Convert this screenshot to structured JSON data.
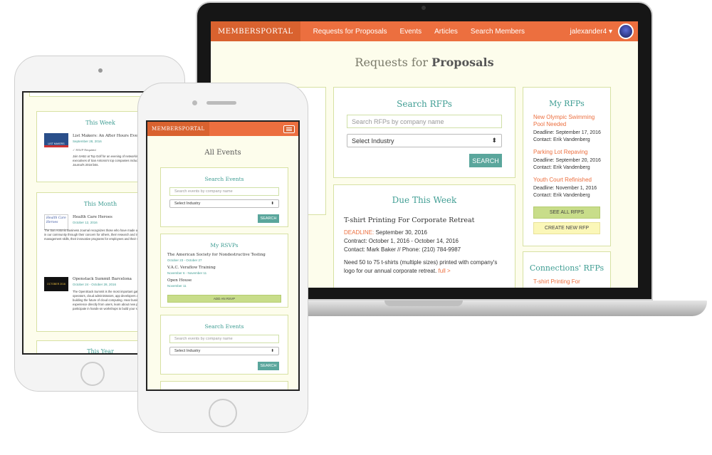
{
  "laptop": {
    "nav": {
      "brand": "MEMBERSPORTAL",
      "links": [
        "Requests for Proposals",
        "Events",
        "Articles",
        "Search Members"
      ],
      "user": "jalexander4 ▾"
    },
    "page_title_light": "Requests for",
    "page_title_bold": "Proposals",
    "search": {
      "title": "Search RFPs",
      "placeholder": "Search RFPs by company name",
      "select": "Select Industry",
      "button": "SEARCH"
    },
    "due": {
      "title": "Due This Week",
      "rfp_title": "T-shirt Printing For Corporate Retreat",
      "deadline_label": "DEADLINE:",
      "deadline": "September 30, 2016",
      "contract_label": "Contract:",
      "contract": "October 1, 2016 - October 14, 2016",
      "contact_label": "Contact:",
      "contact": "Mark Baker  //  Phone: (210) 784-9987",
      "desc": "Need 50 to 75 t-shirts (multiple sizes) printed with company's logo for our annual corporate retreat.",
      "more": "full >"
    },
    "my_rfps": {
      "title": "My RFPs",
      "items": [
        {
          "name": "New Olympic Swimming Pool Needed",
          "deadline": "Deadline: September 17, 2016",
          "contact": "Contact: Erik Vandenberg"
        },
        {
          "name": "Parking Lot Repaving",
          "deadline": "Deadline: September 20, 2016",
          "contact": "Contact: Erik Vandenberg"
        },
        {
          "name": "Youth Court Refinished",
          "deadline": "Deadline: November 1, 2016",
          "contact": "Contact: Erik Vandenberg"
        }
      ],
      "see_all": "SEE ALL RFPS",
      "create": "CREATE NEW RFP"
    },
    "connections": {
      "title": "Connections' RFPs",
      "first": "T-shirt Printing For"
    }
  },
  "tablet": {
    "this_week": {
      "title": "This Week",
      "event": "List Makers: An After Hours Event",
      "date": "September 28, 2016",
      "rsvp": "✓ RSVP Required",
      "thumb": "LIST MAKERS",
      "desc": "Join SABJ at Top Golf for an evening of networking and golf and meet the executives of San Antonio's top companies included in the San Antonio Business Journal's 2016 lists."
    },
    "this_month": {
      "title": "This Month",
      "event1": "Health Care Heroes",
      "date1": "October 12, 2016",
      "thumb1": "Health Care Heroes",
      "desc1": "The San Antonio Business Journal recognizes those who have made an impact on health care in our community through their concern for others, their research and inventions, their management skills, their innovative programs for employees and their services.",
      "event2": "Openstack Summit Barcelona",
      "date2": "October 24 - October 28, 2016",
      "thumb2": "OCTOBER 2016",
      "desc2": "The OpenStack Summit is the most important gathering of IT leaders, telco operators, cloud administrators, app developers and OpenStack contributors building the future of cloud computing. Hear business cases and operational experience directly from users, learn about new products in the ecosystem and participate in hands-on workshops to build your skills."
    },
    "this_year": {
      "title": "This Year"
    }
  },
  "phone": {
    "brand": "MEMBERSPORTAL",
    "page_title": "All Events",
    "search": {
      "title": "Search Events",
      "placeholder": "Search events by company name",
      "select": "Select Industry",
      "button": "SEARCH"
    },
    "rsvps": {
      "title": "My RSVPs",
      "items": [
        {
          "name": "The American Society for Nondestructive Testing",
          "date": "October 23 - October 27"
        },
        {
          "name": "V.A.C. Veraflow Training",
          "date": "November 6 - November 11"
        },
        {
          "name": "Open House",
          "date": "November 11"
        }
      ],
      "add": "ADD AN RSVP"
    },
    "search2": {
      "title": "Search Events",
      "placeholder": "Search events by company name",
      "select": "Select Industry",
      "button": "SEARCH"
    }
  },
  "colors": {
    "accent": "#ec6f3f",
    "teal": "#3f9d93",
    "panel_border": "#d7e1a3",
    "background": "#fdfdec"
  }
}
